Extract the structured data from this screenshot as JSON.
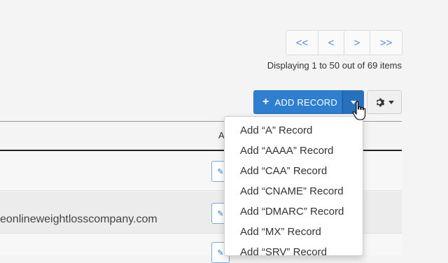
{
  "pager": {
    "first": "<<",
    "prev": "<",
    "next": ">",
    "last": ">>"
  },
  "display_info": "Displaying 1 to 50 out of 69 items",
  "toolbar": {
    "add_record_label": "ADD RECORD",
    "add_icon": "plus-icon",
    "gear_icon": "gear-icon"
  },
  "table": {
    "actions_header": "A",
    "rows": [
      {
        "name": ""
      },
      {
        "name": "eonlineweightlosscompany.com"
      },
      {
        "name": ""
      }
    ]
  },
  "dropdown": {
    "items": [
      "Add “A” Record",
      "Add “AAAA” Record",
      "Add “CAA” Record",
      "Add “CNAME” Record",
      "Add “DMARC” Record",
      "Add “MX” Record",
      "Add “SRV” Record"
    ]
  },
  "colors": {
    "primary": "#2f7fd0",
    "primary_dark": "#2670bd",
    "link": "#5a87c0",
    "background": "#f4f4f4"
  }
}
